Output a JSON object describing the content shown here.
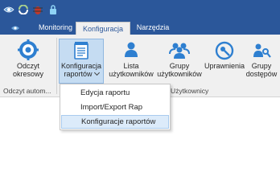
{
  "quick_access": {
    "icons": [
      "eye-icon",
      "sync-icon",
      "bug-icon",
      "lock-icon"
    ]
  },
  "tabs": [
    {
      "label": "",
      "icon": "app-menu-icon"
    },
    {
      "label": "Monitoring"
    },
    {
      "label": "Konfiguracja",
      "active": true
    },
    {
      "label": "Narzędzia"
    }
  ],
  "ribbon": {
    "buttons": {
      "odczyt": "Odczyt\nokresowy",
      "konfiguracja": "Konfiguracja\nraportów",
      "lista": "Lista\nużytkowników",
      "grupy_uzytkownikow": "Grupy\nużytkowników",
      "uprawnienia": "Uprawnienia",
      "grupy_dostepow": "Grupy\ndostępów"
    },
    "groups": {
      "odczyt_group": "Odczyt autom...",
      "users_group": "Użytkownicy"
    }
  },
  "dropdown": {
    "items": [
      "Edycja raportu",
      "Import/Export Rap",
      "Konfiguracje raportów"
    ],
    "hover_index": 2
  },
  "colors": {
    "title_bar": "#2b579a",
    "ribbon_bg": "#f0f0f0",
    "pressed_bg": "#c5dcf2",
    "hover_bg": "#dcebfa",
    "icon_blue": "#2e7fd0"
  }
}
